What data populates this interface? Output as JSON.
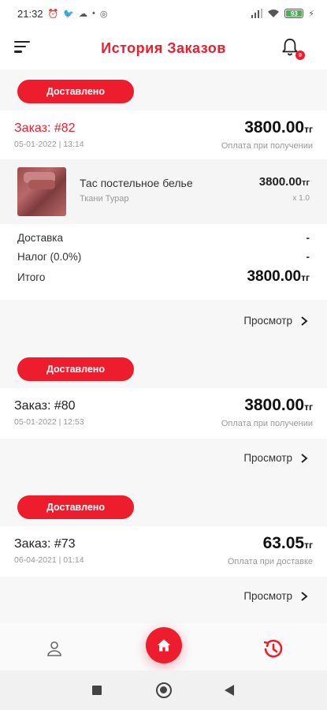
{
  "statusbar": {
    "time": "21:32",
    "battery": "93"
  },
  "header": {
    "title": "История Заказов",
    "bell_badge": "0"
  },
  "orders": [
    {
      "status": "Доставлено",
      "number_label": "Заказ:",
      "number": "#82",
      "date": "05-01-2022 | 13:14",
      "amount": "3800.00",
      "currency": "тг",
      "payment": "Оплата при получении",
      "product": {
        "name": "Тас постельное белье",
        "seller": "Ткани Турар",
        "price": "3800.00",
        "currency": "тг",
        "qty": "x 1.0"
      },
      "totals": {
        "delivery_label": "Доставка",
        "delivery_value": "-",
        "tax_label": "Налог (0.0%)",
        "tax_value": "-",
        "total_label": "Итого",
        "total_value": "3800.00",
        "total_currency": "тг"
      },
      "view_label": "Просмотр"
    },
    {
      "status": "Доставлено",
      "number_label": "Заказ:",
      "number": "#80",
      "date": "05-01-2022 | 12:53",
      "amount": "3800.00",
      "currency": "тг",
      "payment": "Оплата при получении",
      "view_label": "Просмотр"
    },
    {
      "status": "Доставлено",
      "number_label": "Заказ:",
      "number": "#73",
      "date": "06-04-2021 | 01:14",
      "amount": "63.05",
      "currency": "тг",
      "payment": "Оплата при доставке",
      "view_label": "Просмотр"
    }
  ],
  "bottom_nav": {
    "items": [
      "user-icon",
      "home-icon",
      "history-icon"
    ],
    "active": "history-icon"
  },
  "colors": {
    "accent": "#ee1d2e",
    "background": "#f7f7f7"
  }
}
